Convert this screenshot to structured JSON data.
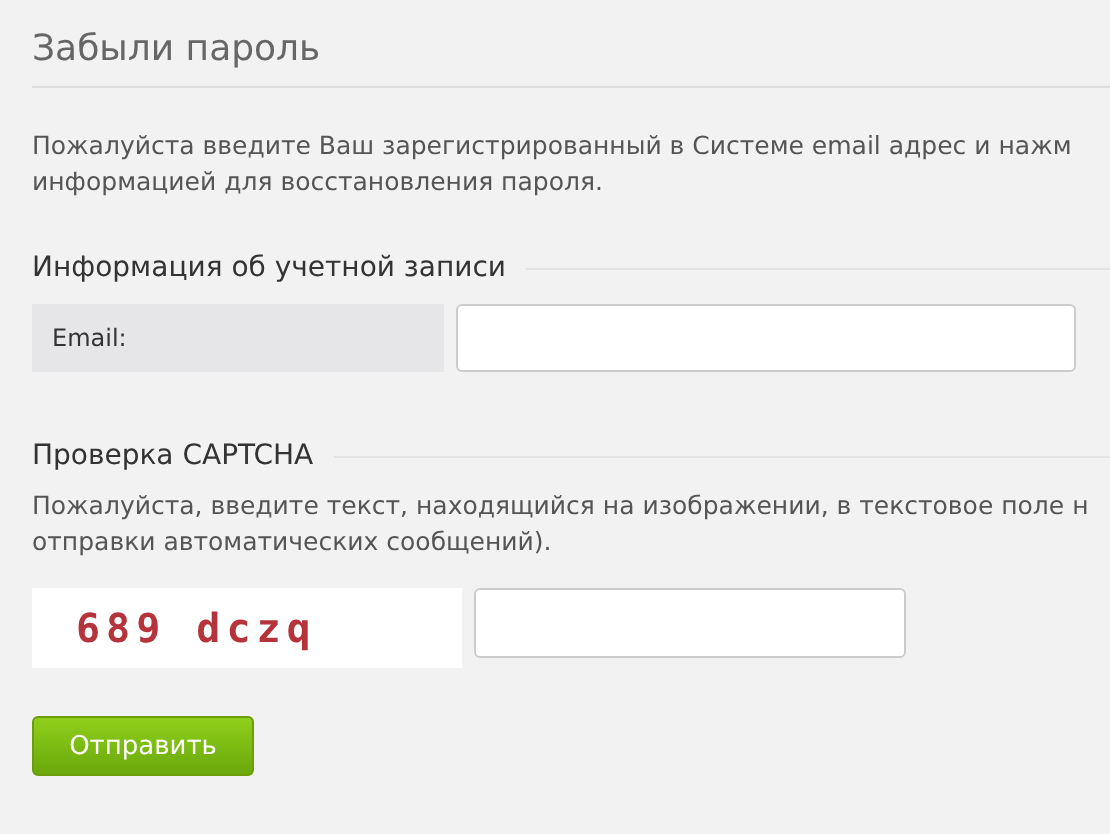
{
  "title": "Забыли пароль",
  "intro": [
    "Пожалуйста введите Ваш зарегистрированный в Системе email адрес и нажм",
    "информацией для восстановления пароля."
  ],
  "account_section": {
    "heading": "Информация об учетной записи",
    "field_label": "Email:"
  },
  "captcha_section": {
    "heading": "Проверка CAPTCHA",
    "text": [
      "Пожалуйста, введите текст, находящийся на изображении, в текстовое поле н",
      "отправки автоматических сообщений)."
    ],
    "captcha_text": "689 dczq"
  },
  "submit_button": "Отправить"
}
